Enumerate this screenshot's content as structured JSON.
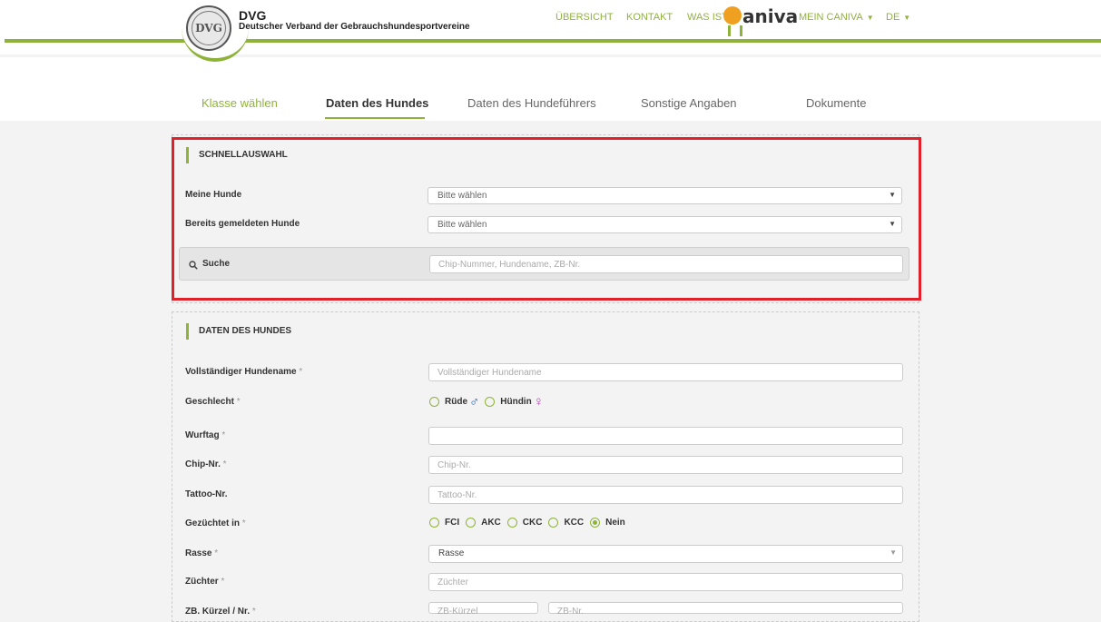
{
  "header": {
    "brand_title": "DVG",
    "brand_subtitle": "Deutscher Verband der Gebrauchshundesportvereine",
    "logo_text": "DVG",
    "nav": {
      "overview": "ÜBERSICHT",
      "contact": "KONTAKT",
      "what_is": "WAS IST",
      "caniva_c": "C",
      "caniva_rest": "aniva",
      "my_caniva": "MEIN CANIVA",
      "language": "DE"
    },
    "icons": {
      "caret": "caret-down-icon"
    }
  },
  "steps": [
    {
      "label": "Klasse wählen",
      "state": "done"
    },
    {
      "label": "Daten des Hundes",
      "state": "active"
    },
    {
      "label": "Daten des Hundeführers",
      "state": "pending"
    },
    {
      "label": "Sonstige Angaben",
      "state": "pending"
    },
    {
      "label": "Dokumente",
      "state": "pending"
    }
  ],
  "quick_select": {
    "title": "SCHNELLAUSWAHL",
    "my_dogs_label": "Meine Hunde",
    "my_dogs_value": "Bitte wählen",
    "registered_dogs_label": "Bereits gemeldeten Hunde",
    "registered_dogs_value": "Bitte wählen",
    "search_label": "Suche",
    "search_placeholder": "Chip-Nummer, Hundename, ZB-Nr."
  },
  "dog_data": {
    "title": "DATEN DES HUNDES",
    "name_label": "Vollständiger Hundename",
    "name_placeholder": "Vollständiger Hundename",
    "gender_label": "Geschlecht",
    "gender_male": "Rüde",
    "gender_female": "Hündin",
    "male_symbol": "♂",
    "female_symbol": "♀",
    "birth_label": "Wurftag",
    "birth_value": "",
    "chip_label": "Chip-Nr.",
    "chip_placeholder": "Chip-Nr.",
    "tattoo_label": "Tattoo-Nr.",
    "tattoo_placeholder": "Tattoo-Nr.",
    "bred_label": "Gezüchtet in",
    "bred_options": [
      "FCI",
      "AKC",
      "CKC",
      "KCC",
      "Nein"
    ],
    "bred_selected": "Nein",
    "breed_label": "Rasse",
    "breed_value": "Rasse",
    "breeder_label": "Züchter",
    "breeder_placeholder": "Züchter",
    "zb_label": "ZB. Kürzel / Nr.",
    "zb_short_placeholder": "ZB-Kürzel",
    "zb_nr_placeholder": "ZB-Nr.",
    "required_mark": "*"
  },
  "colors": {
    "accent": "#8fb33a",
    "highlight": "#e0212b",
    "male": "#2b62b8",
    "female": "#c43ac7"
  }
}
